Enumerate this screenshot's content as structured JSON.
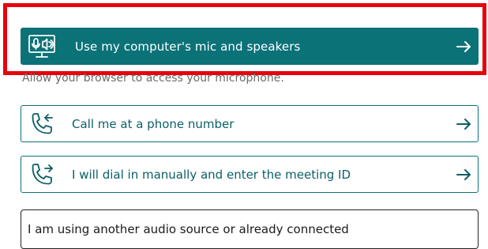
{
  "options": {
    "computer_audio": {
      "label": "Use my computer's mic and speakers",
      "icon": "computer-audio-icon",
      "hint": "Allow your browser to access your microphone."
    },
    "call_me": {
      "label": "Call me at a phone number",
      "icon": "phone-incoming-icon"
    },
    "dial_in": {
      "label": "I will dial in manually and enter the meeting ID",
      "icon": "phone-outgoing-icon"
    },
    "other_source": {
      "label": "I am using another audio source or already connected"
    }
  },
  "colors": {
    "accent": "#0b7278",
    "highlight": "#e8000b",
    "hint_text": "#6b6b6b"
  }
}
